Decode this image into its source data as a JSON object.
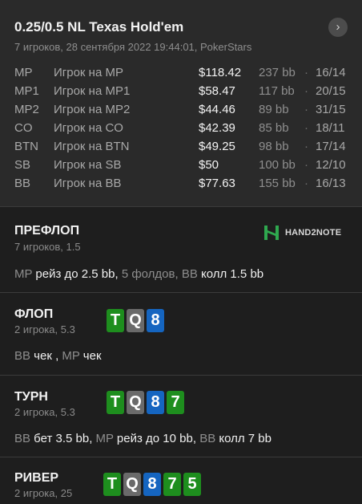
{
  "hand": {
    "title": "0.25/0.5 NL Texas Hold'em",
    "subtitle": "7 игроков, 28 сентября 2022 19:44:01, PokerStars",
    "next_icon": "chevron-right-icon"
  },
  "players": [
    {
      "pos": "MP",
      "name": "Игрок на MP",
      "stack": "$118.42",
      "bb": "237 bb",
      "stat": "16/14"
    },
    {
      "pos": "MP1",
      "name": "Игрок на MP1",
      "stack": "$58.47",
      "bb": "117 bb",
      "stat": "20/15"
    },
    {
      "pos": "MP2",
      "name": "Игрок на MP2",
      "stack": "$44.46",
      "bb": "89 bb",
      "stat": "31/15"
    },
    {
      "pos": "CO",
      "name": "Игрок на CO",
      "stack": "$42.39",
      "bb": "85 bb",
      "stat": "18/11"
    },
    {
      "pos": "BTN",
      "name": "Игрок на BTN",
      "stack": "$49.25",
      "bb": "98 bb",
      "stat": "17/14"
    },
    {
      "pos": "SB",
      "name": "Игрок на SB",
      "stack": "$50",
      "bb": "100 bb",
      "stat": "12/10"
    },
    {
      "pos": "BB",
      "name": "Игрок на BB",
      "stack": "$77.63",
      "bb": "155 bb",
      "stat": "16/13"
    }
  ],
  "dot": "·",
  "logo_text": "HAND2NOTE",
  "colors": {
    "spades": "#2e2e2e",
    "hearts": "#c62828",
    "clubs": "#1e8e1e",
    "diamonds": "#1565c0",
    "spade_gray": "#6a6a6a"
  },
  "streets": {
    "preflop": {
      "title": "ПРЕФЛОП",
      "sub": "7 игроков, 1.5",
      "actions": [
        {
          "pos": "MP",
          "text": " рейз до 2.5 bb, "
        },
        {
          "muted": "5 фолдов, "
        },
        {
          "pos": "BB",
          "text": " колл 1.5 bb"
        }
      ]
    },
    "flop": {
      "title": "ФЛОП",
      "sub": "2 игрока, 5.3",
      "cards": [
        {
          "r": "T",
          "s": "clubs"
        },
        {
          "r": "Q",
          "s": "spades"
        },
        {
          "r": "8",
          "s": "diamonds"
        }
      ],
      "actions": [
        {
          "pos": "BB",
          "text": " чек , "
        },
        {
          "pos": "MP",
          "text": " чек"
        }
      ]
    },
    "turn": {
      "title": "ТУРН",
      "sub": "2 игрока, 5.3",
      "cards": [
        {
          "r": "T",
          "s": "clubs"
        },
        {
          "r": "Q",
          "s": "spades"
        },
        {
          "r": "8",
          "s": "diamonds"
        },
        {
          "r": "7",
          "s": "clubs"
        }
      ],
      "actions": [
        {
          "pos": "BB",
          "text": " бет 3.5 bb, "
        },
        {
          "pos": "MP",
          "text": " рейз до 10 bb, "
        },
        {
          "pos": "BB",
          "text": " колл 7 bb"
        }
      ]
    },
    "river": {
      "title": "РИВЕР",
      "sub": "2 игрока, 25",
      "cards": [
        {
          "r": "T",
          "s": "clubs"
        },
        {
          "r": "Q",
          "s": "spades"
        },
        {
          "r": "8",
          "s": "diamonds"
        },
        {
          "r": "7",
          "s": "clubs"
        },
        {
          "r": "5",
          "s": "clubs"
        }
      ]
    }
  }
}
